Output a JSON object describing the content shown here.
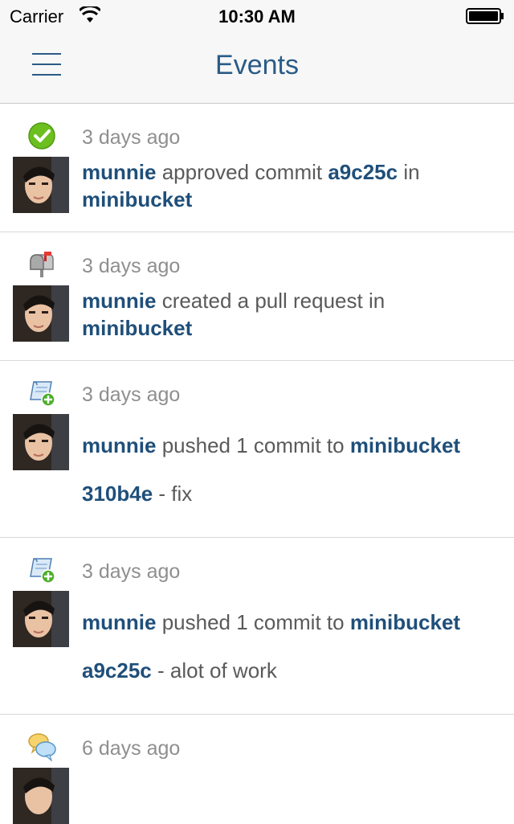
{
  "status_bar": {
    "carrier": "Carrier",
    "time": "10:30 AM"
  },
  "nav": {
    "title": "Events"
  },
  "events": [
    {
      "icon": "approved-check-icon",
      "time": "3 days ago",
      "user": "munnie",
      "action": "approved commit",
      "target": "a9c25c",
      "connector": "in",
      "repo": "minibucket"
    },
    {
      "icon": "mailbox-icon",
      "time": "3 days ago",
      "user": "munnie",
      "action": "created a pull request in",
      "repo": "minibucket"
    },
    {
      "icon": "commit-scroll-icon",
      "time": "3 days ago",
      "user": "munnie",
      "action": "pushed 1 commit to",
      "repo": "minibucket",
      "commit_hash": "310b4e",
      "commit_message": "- fix"
    },
    {
      "icon": "commit-scroll-icon",
      "time": "3 days ago",
      "user": "munnie",
      "action": "pushed 1 commit to",
      "repo": "minibucket",
      "commit_hash": "a9c25c",
      "commit_message": "- alot of work"
    },
    {
      "icon": "comment-bubbles-icon",
      "time": "6 days ago"
    }
  ],
  "colors": {
    "accent": "#2a5b86",
    "link": "#1f4f7a",
    "muted": "#8f8f8f",
    "success": "#6cbf1e"
  }
}
